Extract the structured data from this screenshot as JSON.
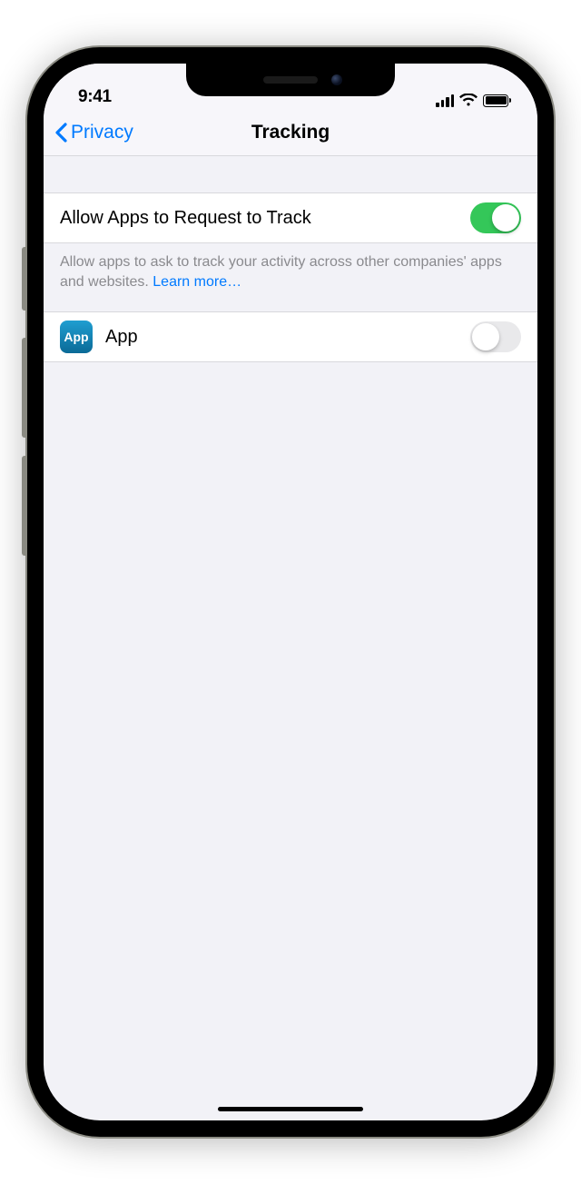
{
  "status": {
    "time": "9:41"
  },
  "nav": {
    "back_label": "Privacy",
    "title": "Tracking"
  },
  "main": {
    "allow_label": "Allow Apps to Request to Track",
    "allow_enabled": true,
    "footer_text": "Allow apps to ask to track your activity across other companies' apps and websites. ",
    "learn_more": "Learn more…"
  },
  "apps": [
    {
      "name": "App",
      "icon_text": "App",
      "enabled": false
    }
  ]
}
